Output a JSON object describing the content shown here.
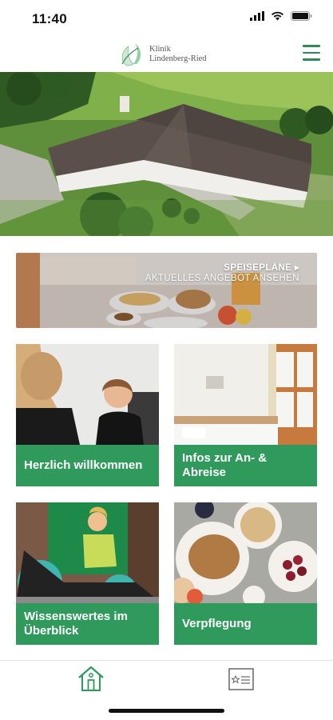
{
  "status_bar": {
    "time": "11:40"
  },
  "header": {
    "logo_line1": "Klinik",
    "logo_line2": "Lindenberg-Ried",
    "menu_icon": "hamburger-menu-icon"
  },
  "banner": {
    "title": "SPEISEPLÄNE ▸",
    "subtitle": "AKTUELLES ANGEBOT ANSEHEN"
  },
  "tiles": [
    {
      "label": "Herzlich willkommen"
    },
    {
      "label": "Infos zur An- & Abreise"
    },
    {
      "label": "Wissenswertes im Überblick"
    },
    {
      "label": "Verpflegung"
    }
  ],
  "tab_bar": {
    "tabs": [
      "home-icon",
      "document-star-icon"
    ]
  },
  "colors": {
    "accent": "#2f9a5c",
    "menu": "#2e8b57"
  }
}
